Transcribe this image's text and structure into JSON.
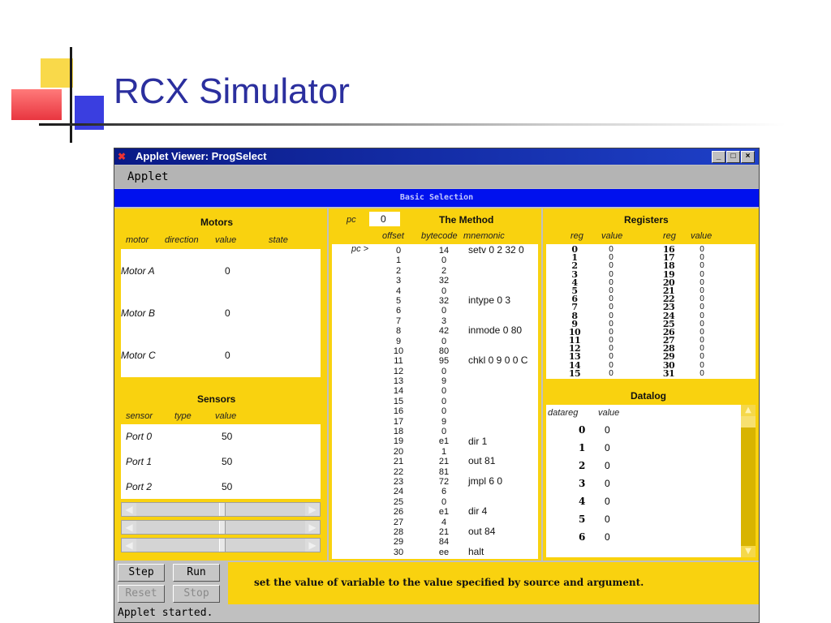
{
  "slide": {
    "title": "RCX Simulator"
  },
  "window": {
    "title": "Applet Viewer: ProgSelect",
    "buttons": {
      "minimize": "_",
      "maximize": "□",
      "close": "×"
    }
  },
  "menubar": {
    "items": [
      "Applet"
    ]
  },
  "banner": {
    "text": "Basic Selection"
  },
  "motors": {
    "header": "Motors",
    "columns": [
      "motor",
      "direction",
      "value",
      "state"
    ],
    "rows": [
      {
        "motor": "Motor A",
        "value": "0"
      },
      {
        "motor": "Motor B",
        "value": "0"
      },
      {
        "motor": "Motor C",
        "value": "0"
      }
    ]
  },
  "sensors": {
    "header": "Sensors",
    "columns": [
      "sensor",
      "type",
      "value"
    ],
    "rows": [
      {
        "sensor": "Port 0",
        "value": "50"
      },
      {
        "sensor": "Port 1",
        "value": "50"
      },
      {
        "sensor": "Port 2",
        "value": "50"
      }
    ]
  },
  "method": {
    "header": "The Method",
    "pc_label": "pc",
    "pc_value": "0",
    "columns": [
      "offset",
      "bytecode",
      "mnemonic"
    ],
    "pc_marker": "pc >",
    "offsets": [
      "0",
      "1",
      "2",
      "3",
      "4",
      "5",
      "6",
      "7",
      "8",
      "9",
      "10",
      "11",
      "12",
      "13",
      "14",
      "15",
      "16",
      "17",
      "18",
      "19",
      "20",
      "21",
      "22",
      "23",
      "24",
      "25",
      "26",
      "27",
      "28",
      "29",
      "30"
    ],
    "bytecodes": [
      "14",
      "0",
      "2",
      "32",
      "0",
      "32",
      "0",
      "3",
      "42",
      "0",
      "80",
      "95",
      "0",
      "9",
      "0",
      "0",
      "0",
      "9",
      "0",
      "e1",
      "1",
      "21",
      "81",
      "72",
      "6",
      "0",
      "e1",
      "4",
      "21",
      "84",
      "ee"
    ],
    "mnemonics": [
      {
        "offset_index": 0,
        "text": "setv 0 2 32 0"
      },
      {
        "offset_index": 5,
        "text": "intype 0 3"
      },
      {
        "offset_index": 8,
        "text": "inmode 0 80"
      },
      {
        "offset_index": 11,
        "text": "chkl 0 9 0 0 C"
      },
      {
        "offset_index": 19,
        "text": "dir 1"
      },
      {
        "offset_index": 21,
        "text": "out 81"
      },
      {
        "offset_index": 23,
        "text": "jmpl 6 0"
      },
      {
        "offset_index": 26,
        "text": "dir 4"
      },
      {
        "offset_index": 28,
        "text": "out 84"
      },
      {
        "offset_index": 30,
        "text": "halt"
      }
    ]
  },
  "registers": {
    "header": "Registers",
    "columns": [
      "reg",
      "value",
      "reg",
      "value"
    ],
    "left_regs": [
      "0",
      "1",
      "2",
      "3",
      "4",
      "5",
      "6",
      "7",
      "8",
      "9",
      "10",
      "11",
      "12",
      "13",
      "14",
      "15"
    ],
    "left_values": [
      "0",
      "0",
      "0",
      "0",
      "0",
      "0",
      "0",
      "0",
      "0",
      "0",
      "0",
      "0",
      "0",
      "0",
      "0",
      "0"
    ],
    "right_regs": [
      "16",
      "17",
      "18",
      "19",
      "20",
      "21",
      "22",
      "23",
      "24",
      "25",
      "26",
      "27",
      "28",
      "29",
      "30",
      "31"
    ],
    "right_values": [
      "0",
      "0",
      "0",
      "0",
      "0",
      "0",
      "0",
      "0",
      "0",
      "0",
      "0",
      "0",
      "0",
      "0",
      "0",
      "0"
    ]
  },
  "datalog": {
    "header": "Datalog",
    "columns": [
      "datareg",
      "value"
    ],
    "rows": [
      {
        "reg": "0",
        "value": "0"
      },
      {
        "reg": "1",
        "value": "0"
      },
      {
        "reg": "2",
        "value": "0"
      },
      {
        "reg": "3",
        "value": "0"
      },
      {
        "reg": "4",
        "value": "0"
      },
      {
        "reg": "5",
        "value": "0"
      },
      {
        "reg": "6",
        "value": "0"
      }
    ]
  },
  "controls": {
    "step": "Step",
    "run": "Run",
    "reset": "Reset",
    "stop": "Stop"
  },
  "description": "set the value of variable to the value specified by source and argument.",
  "status": "Applet started.",
  "colors": {
    "panel_yellow": "#f9d20f",
    "banner_blue": "#0011ee",
    "title_blue": "#2b2f9e"
  }
}
